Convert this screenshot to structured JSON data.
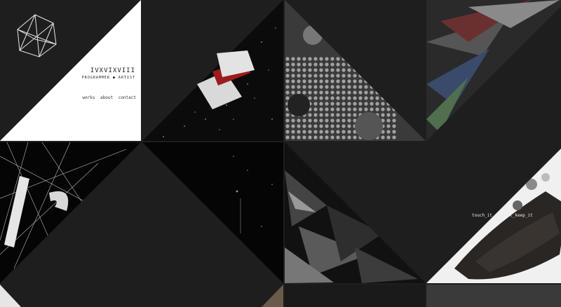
{
  "site": {
    "name": "IVXVIXVIII",
    "role": "PROGRAMMER ● ARTIST",
    "nav": [
      {
        "label": "works"
      },
      {
        "label": "about"
      },
      {
        "label": "contact"
      }
    ]
  },
  "work_caption": "touch_it_read_it_keep_it",
  "colors": {
    "background": "#1e1e1e",
    "tile_dark": "#1c1c1c",
    "white": "#ffffff",
    "accent_red": "#9b1c1c"
  },
  "icons": {
    "logo": "wireframe-icosahedron-icon"
  }
}
